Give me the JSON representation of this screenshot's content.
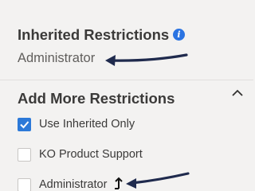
{
  "inherited": {
    "title": "Inherited Restrictions",
    "info_icon": "info-icon",
    "value": "Administrator"
  },
  "add_more": {
    "title": "Add More Restrictions",
    "collapse_icon": "chevron-up-icon",
    "options": [
      {
        "label": "Use Inherited Only",
        "checked": true
      },
      {
        "label": "KO Product Support",
        "checked": false
      },
      {
        "label": "Administrator",
        "checked": false
      }
    ]
  },
  "colors": {
    "accent": "#2c79d8",
    "annotation_arrow": "#1f2a4d"
  }
}
